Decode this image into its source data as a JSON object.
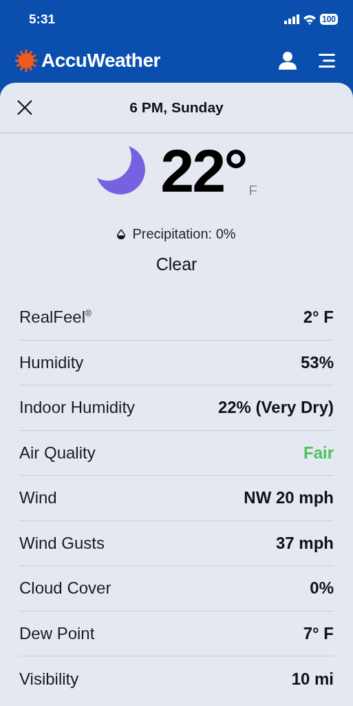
{
  "status_bar": {
    "time": "5:31",
    "battery": "100"
  },
  "header": {
    "brand": "AccuWeather"
  },
  "sheet": {
    "title": "6 PM, Sunday"
  },
  "current": {
    "temperature": "22°",
    "unit": "F",
    "precipitation": "Precipitation: 0%",
    "condition": "Clear"
  },
  "rows": [
    {
      "label": "RealFeel$^{®}$",
      "value": "2° F"
    },
    {
      "label": "Humidity",
      "value": "53%"
    },
    {
      "label": "Indoor Humidity",
      "value": "22% (Very Dry)"
    },
    {
      "label": "Air Quality",
      "value": "Fair",
      "color": "#4cc35a"
    },
    {
      "label": "Wind",
      "value": "NW 20 mph"
    },
    {
      "label": "Wind Gusts",
      "value": "37 mph"
    },
    {
      "label": "Cloud Cover",
      "value": "0%"
    },
    {
      "label": "Dew Point",
      "value": "7° F"
    },
    {
      "label": "Visibility",
      "value": "10 mi"
    }
  ]
}
